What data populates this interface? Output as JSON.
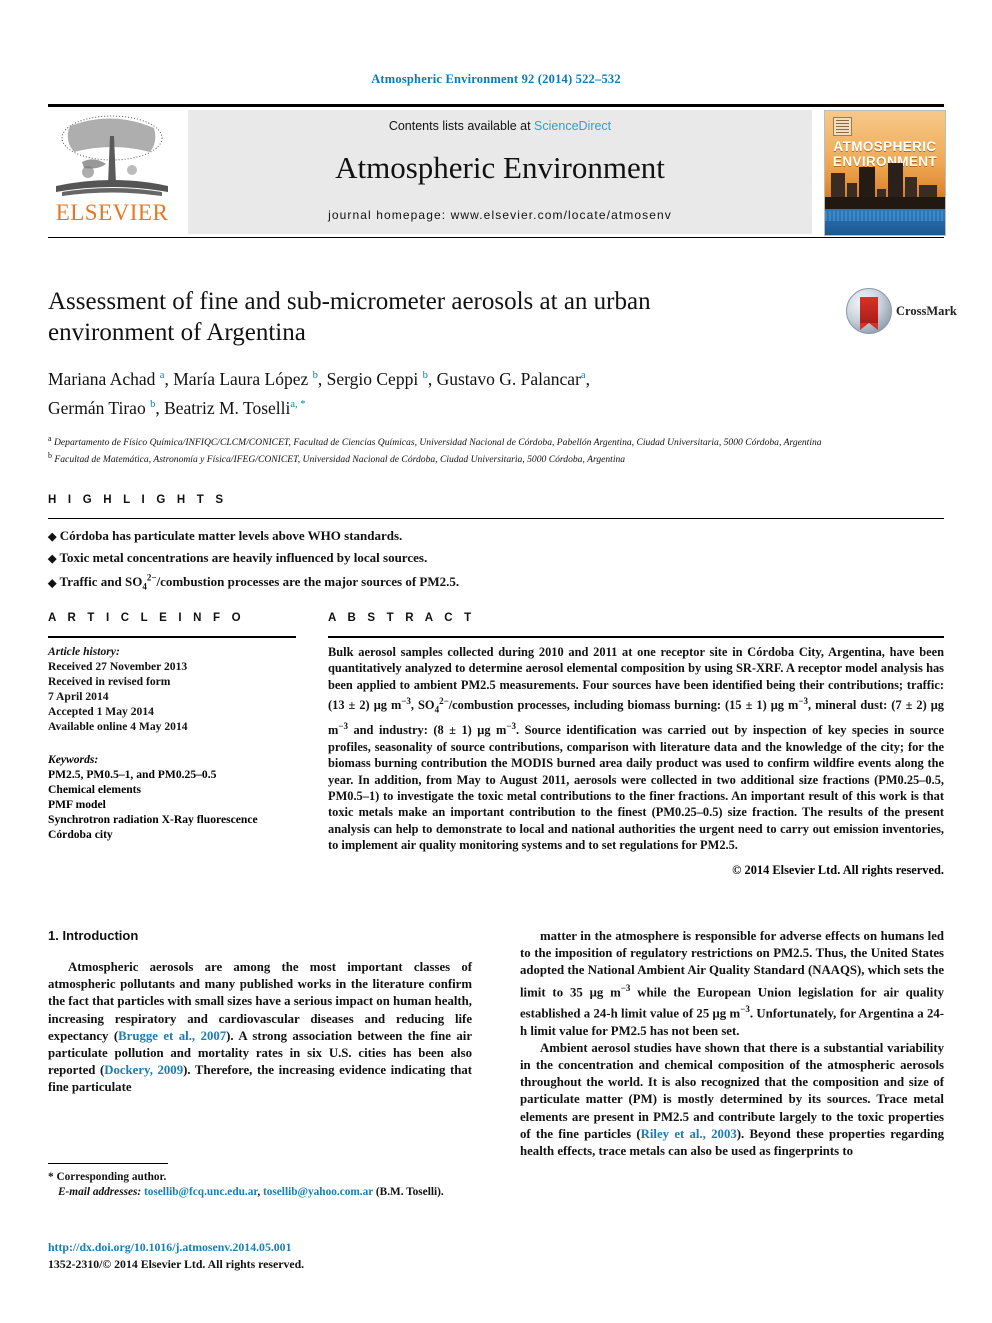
{
  "running_head": "Atmospheric Environment 92 (2014) 522–532",
  "masthead": {
    "contents_prefix": "Contents lists available at ",
    "sciencedirect": "ScienceDirect",
    "journal_title": "Atmospheric Environment",
    "homepage": "journal homepage: www.elsevier.com/locate/atmosenv",
    "publisher": "ELSEVIER",
    "cover_title_line1": "ATMOSPHERIC",
    "cover_title_line2": "ENVIRONMENT",
    "accent_link_color": "#2f9fd0",
    "publisher_color": "#e87722"
  },
  "article": {
    "title": "Assessment of fine and sub-micrometer aerosols at an urban environment of Argentina",
    "authors_line1": "Mariana Achad <sup>a</sup>, María Laura López <sup>b</sup>, Sergio Ceppi <sup>b</sup>, Gustavo G. Palancar<sup>a</sup>,",
    "authors_line2": "Germán Tirao <sup>b</sup>, Beatriz M. Toselli<sup>a, *</sup>",
    "affiliation_a": "<sup>a</sup> Departamento de Físico Química/INFIQC/CLCM/CONICET, Facultad de Ciencias Químicas, Universidad Nacional de Córdoba, Pabellón Argentina, Ciudad Universitaria, 5000 Córdoba, Argentina",
    "affiliation_b": "<sup>b</sup> Facultad de Matemática, Astronomía y Física/IFEG/CONICET, Universidad Nacional de Córdoba, Ciudad Universitaria, 5000 Córdoba, Argentina",
    "crossmark_label": "CrossMark"
  },
  "highlights": {
    "heading": "H I G H L I G H T S",
    "items": [
      "Córdoba has particulate matter levels above WHO standards.",
      "Toxic metal concentrations are heavily influenced by local sources.",
      "Traffic and SO<sub>4</sub><sup>2−</sup>/combustion processes are the major sources of PM2.5."
    ]
  },
  "article_info": {
    "heading": "A R T I C L E   I N F O",
    "history_label": "Article history:",
    "history": [
      "Received 27 November 2013",
      "Received in revised form",
      "7 April 2014",
      "Accepted 1 May 2014",
      "Available online 4 May 2014"
    ],
    "keywords_label": "Keywords:",
    "keywords": [
      "PM2.5, PM0.5–1, and PM0.25–0.5",
      "Chemical elements",
      "PMF model",
      "Synchrotron radiation X-Ray fluorescence",
      "Córdoba city"
    ]
  },
  "abstract": {
    "heading": "A B S T R A C T",
    "text": "Bulk aerosol samples collected during 2010 and 2011 at one receptor site in Córdoba City, Argentina, have been quantitatively analyzed to determine aerosol elemental composition by using SR-XRF. A receptor model analysis has been applied to ambient PM2.5 measurements. Four sources have been identified being their contributions; traffic: (13 ± 2) μg m<sup>−3</sup>, SO<sub>4</sub><sup>2−</sup>/combustion processes, including biomass burning: (15 ± 1) μg m<sup>−3</sup>, mineral dust: (7 ± 2) μg m<sup>−3</sup> and industry: (8 ± 1) μg m<sup>−3</sup>. Source identification was carried out by inspection of key species in source profiles, seasonality of source contributions, comparison with literature data and the knowledge of the city; for the biomass burning contribution the MODIS burned area daily product was used to confirm wildfire events along the year. In addition, from May to August 2011, aerosols were collected in two additional size fractions (PM0.25–0.5, PM0.5–1) to investigate the toxic metal contributions to the finer fractions. An important result of this work is that toxic metals make an important contribution to the finest (PM0.25–0.5) size fraction. The results of the present analysis can help to demonstrate to local and national authorities the urgent need to carry out emission inventories, to implement air quality monitoring systems and to set regulations for PM2.5.",
    "copyright": "© 2014 Elsevier Ltd. All rights reserved."
  },
  "introduction": {
    "heading": "1. Introduction",
    "left_paragraph": "Atmospheric aerosols are among the most important classes of atmospheric pollutants and many published works in the literature confirm the fact that particles with small sizes have a serious impact on human health, increasing respiratory and cardiovascular diseases and reducing life expectancy (<a class=\"ref\" href=\"#\">Brugge et al., 2007</a>). A strong association between the fine air particulate pollution and mortality rates in six U.S. cities has been also reported (<a class=\"ref\" href=\"#\">Dockery, 2009</a>). Therefore, the increasing evidence indicating that fine particulate",
    "right_paragraph_1": "matter in the atmosphere is responsible for adverse effects on humans led to the imposition of regulatory restrictions on PM2.5. Thus, the United States adopted the National Ambient Air Quality Standard (NAAQS), which sets the limit to 35 μg m<sup>−3</sup> while the European Union legislation for air quality established a 24-h limit value of 25 μg m<sup>−3</sup>. Unfortunately, for Argentina a 24-h limit value for PM2.5 has not been set.",
    "right_paragraph_2": "Ambient aerosol studies have shown that there is a substantial variability in the concentration and chemical composition of the atmospheric aerosols throughout the world. It is also recognized that the composition and size of particulate matter (PM) is mostly determined by its sources. Trace metal elements are present in PM2.5 and contribute largely to the toxic properties of the fine particles (<a class=\"ref\" href=\"#\">Riley et al., 2003</a>). Beyond these properties regarding health effects, trace metals can also be used as fingerprints to"
  },
  "footer": {
    "corresponding_author": "* Corresponding author.",
    "email_label": "E-mail addresses:",
    "email_1": "tosellib@fcq.unc.edu.ar",
    "email_2": "tosellib@yahoo.com.ar",
    "email_owner": "(B.M. Toselli).",
    "doi": "http://dx.doi.org/10.1016/j.atmosenv.2014.05.001",
    "issn_line": "1352-2310/© 2014 Elsevier Ltd. All rights reserved."
  }
}
